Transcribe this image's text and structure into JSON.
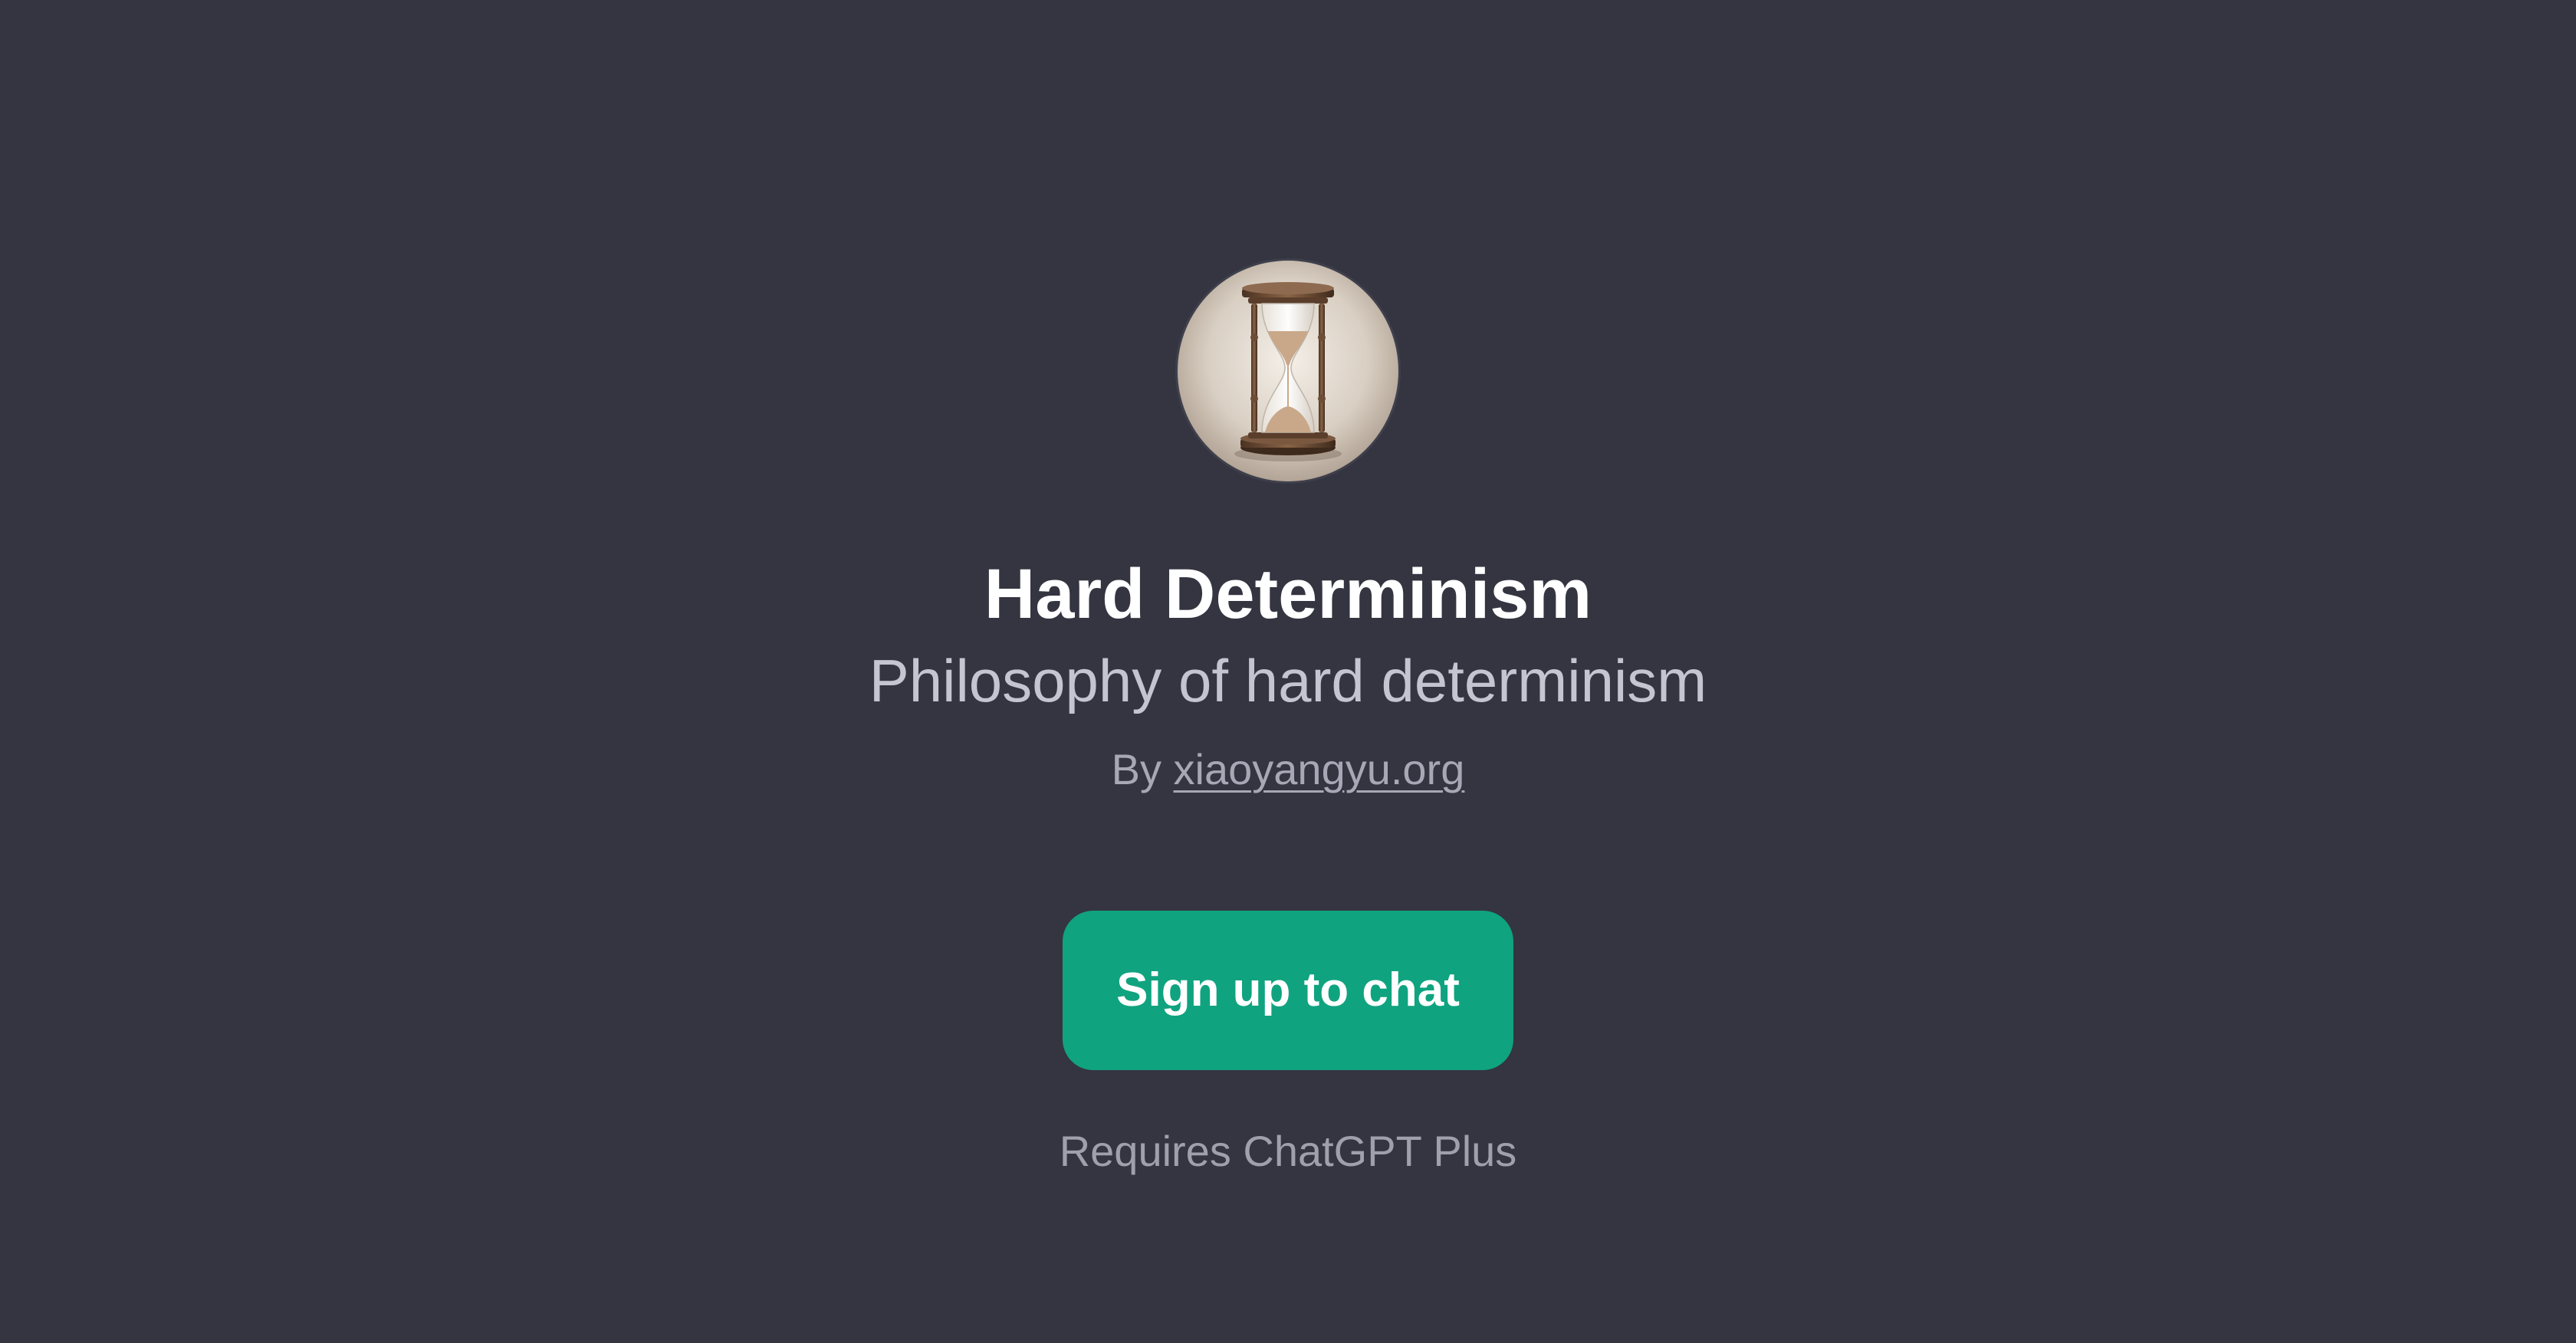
{
  "gpt": {
    "name": "Hard Determinism",
    "description": "Philosophy of hard determinism",
    "by_prefix": "By",
    "author": "xiaoyangyu.org",
    "avatar_icon": "hourglass-icon"
  },
  "cta": {
    "signup_label": "Sign up to chat",
    "requirement": "Requires ChatGPT Plus"
  },
  "colors": {
    "background": "#343541",
    "accent": "#10a37f",
    "title": "#ffffff",
    "subtitle": "#c5c5d2",
    "muted": "#a0a0ad"
  }
}
